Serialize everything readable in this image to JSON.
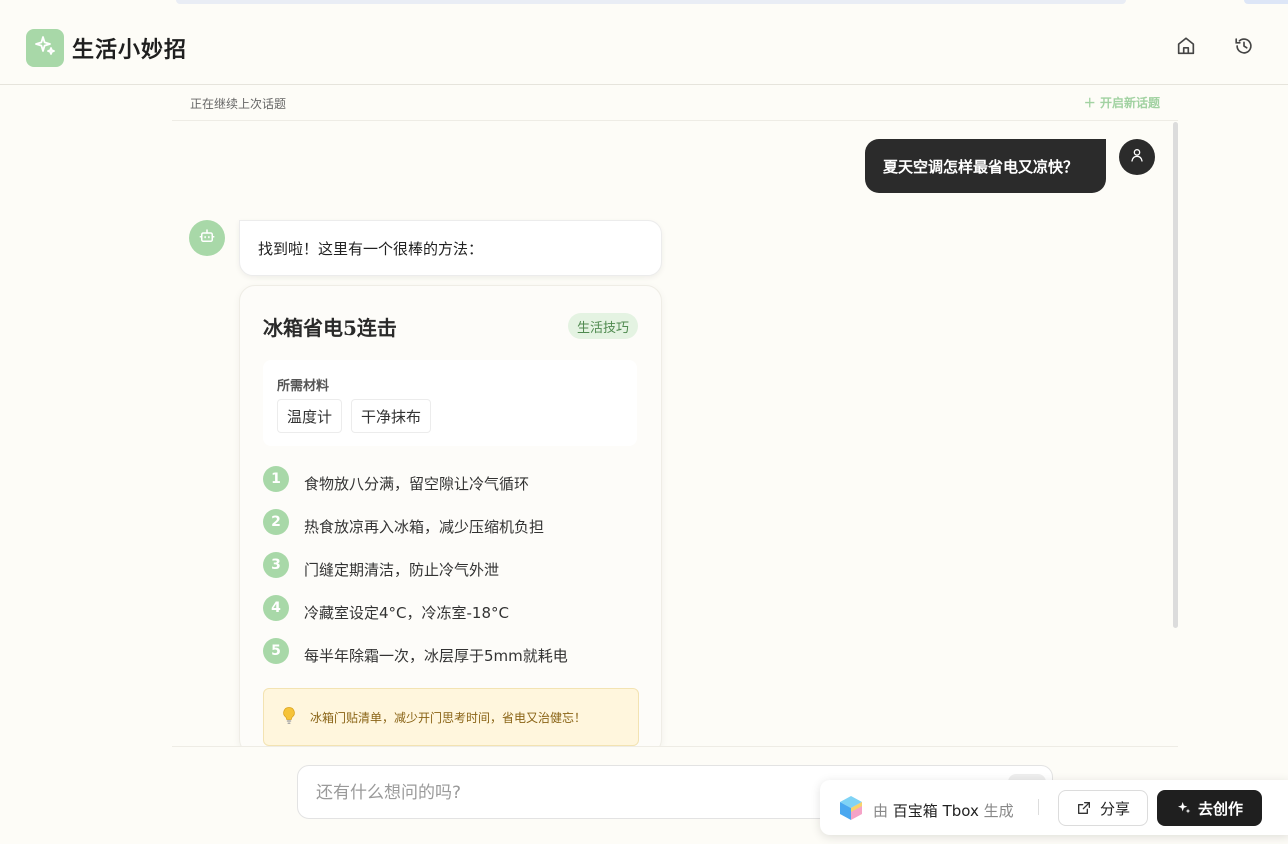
{
  "app": {
    "title": "生活小妙招"
  },
  "subbar": {
    "status": "正在继续上次话题",
    "new_topic": "开启新话题"
  },
  "user_message": "夏天空调怎样最省电又凉快？",
  "bot_message": "找到啦！这里有一个很棒的方法：",
  "card": {
    "title": "冰箱省电5连击",
    "tag": "生活技巧",
    "materials_label": "所需材料",
    "materials": [
      "温度计",
      "干净抹布"
    ],
    "steps": [
      {
        "num": "1",
        "text": "食物放八分满，留空隙让冷气循环"
      },
      {
        "num": "2",
        "text": "热食放凉再入冰箱，减少压缩机负担"
      },
      {
        "num": "3",
        "text": "门缝定期清洁，防止冷气外泄"
      },
      {
        "num": "4",
        "text": "冷藏室设定4°C，冷冻室-18°C"
      },
      {
        "num": "5",
        "text": "每半年除霜一次，冰层厚于5mm就耗电"
      }
    ],
    "tip": "冰箱门贴清单，减少开门思考时间，省电又治健忘！"
  },
  "input": {
    "placeholder": "还有什么想问的吗?"
  },
  "footer": {
    "brand_prefix": "由",
    "brand_name": "百宝箱 Tbox",
    "brand_suffix": "生成",
    "share_label": "分享",
    "create_label": "去创作"
  },
  "colors": {
    "accent": "#a8d8a8",
    "dark": "#2b2b2b",
    "tip_bg": "#fff6dd"
  },
  "icons": [
    "sparkle-icon",
    "home-icon",
    "history-icon",
    "plus-icon",
    "user-icon",
    "robot-icon",
    "lightbulb-icon",
    "tbox-logo-icon",
    "share-icon"
  ]
}
